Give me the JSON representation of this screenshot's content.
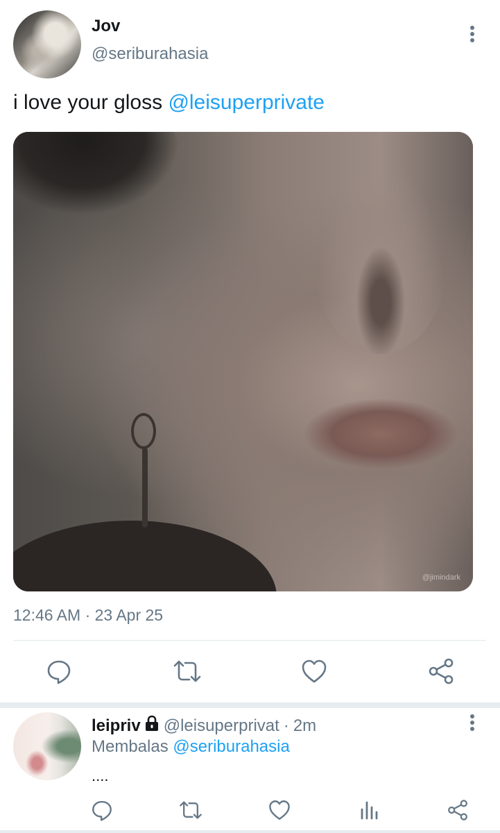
{
  "tweet": {
    "display_name": "Jov",
    "handle": "@seriburahasia",
    "text": "i love your gloss ",
    "mention": "@leisuperprivate",
    "timestamp": "12:46 AM · 23 Apr 25",
    "media": {
      "watermark": "@jimindark"
    },
    "actions": {
      "reply_icon": "reply-icon",
      "retweet_icon": "retweet-icon",
      "like_icon": "heart-icon",
      "share_icon": "share-icon"
    }
  },
  "reply": {
    "display_name": "leipriv",
    "handle": "@leisuperprivat",
    "separator": "·",
    "time": "2m",
    "replying_prefix": "Membalas ",
    "replying_to": "@seriburahasia",
    "text": "....",
    "actions": {
      "reply_icon": "reply-icon",
      "retweet_icon": "retweet-icon",
      "like_icon": "heart-icon",
      "stats_icon": "analytics-icon",
      "share_icon": "share-icon"
    }
  },
  "colors": {
    "accent": "#1da1f2",
    "text_primary": "#14171a",
    "text_secondary": "#657786",
    "icon": "#657786",
    "divider": "#e1e8ed"
  }
}
